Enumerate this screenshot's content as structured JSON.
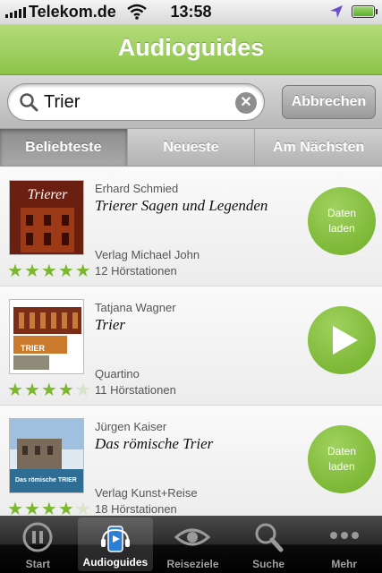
{
  "status_bar": {
    "carrier": "Telekom.de",
    "time": "13:58"
  },
  "nav": {
    "title": "Audioguides"
  },
  "search": {
    "value": "Trier",
    "cancel_label": "Abbrechen"
  },
  "segments": [
    {
      "label": "Beliebteste",
      "active": true
    },
    {
      "label": "Neueste",
      "active": false
    },
    {
      "label": "Am Nächsten",
      "active": false
    }
  ],
  "items": [
    {
      "author": "Erhard Schmied",
      "title": "Trierer Sagen und Legenden",
      "publisher": "Verlag Michael John",
      "stations": "12 Hörstationen",
      "rating": 5,
      "action": "Daten laden",
      "cover_text": "Trierer"
    },
    {
      "author": "Tatjana Wagner",
      "title": "Trier",
      "publisher": "Quartino",
      "stations": "11 Hörstationen",
      "rating": 4,
      "action": "play",
      "cover_text": "TRIER"
    },
    {
      "author": "Jürgen Kaiser",
      "title": "Das römische Trier",
      "publisher": "Verlag Kunst+Reise",
      "stations": "18 Hörstationen",
      "rating": 4,
      "action": "Daten laden",
      "cover_text": "Das römische TRIER"
    }
  ],
  "tabs": [
    {
      "label": "Start",
      "icon": "start-icon",
      "active": false
    },
    {
      "label": "Audioguides",
      "icon": "audioguides-icon",
      "active": true
    },
    {
      "label": "Reiseziele",
      "icon": "eye-icon",
      "active": false
    },
    {
      "label": "Suche",
      "icon": "search-icon",
      "active": false
    },
    {
      "label": "Mehr",
      "icon": "more-icon",
      "active": false
    }
  ],
  "colors": {
    "accent": "#8cc44a",
    "star_on": "#7cb82f",
    "star_off": "#d8e3c8"
  }
}
